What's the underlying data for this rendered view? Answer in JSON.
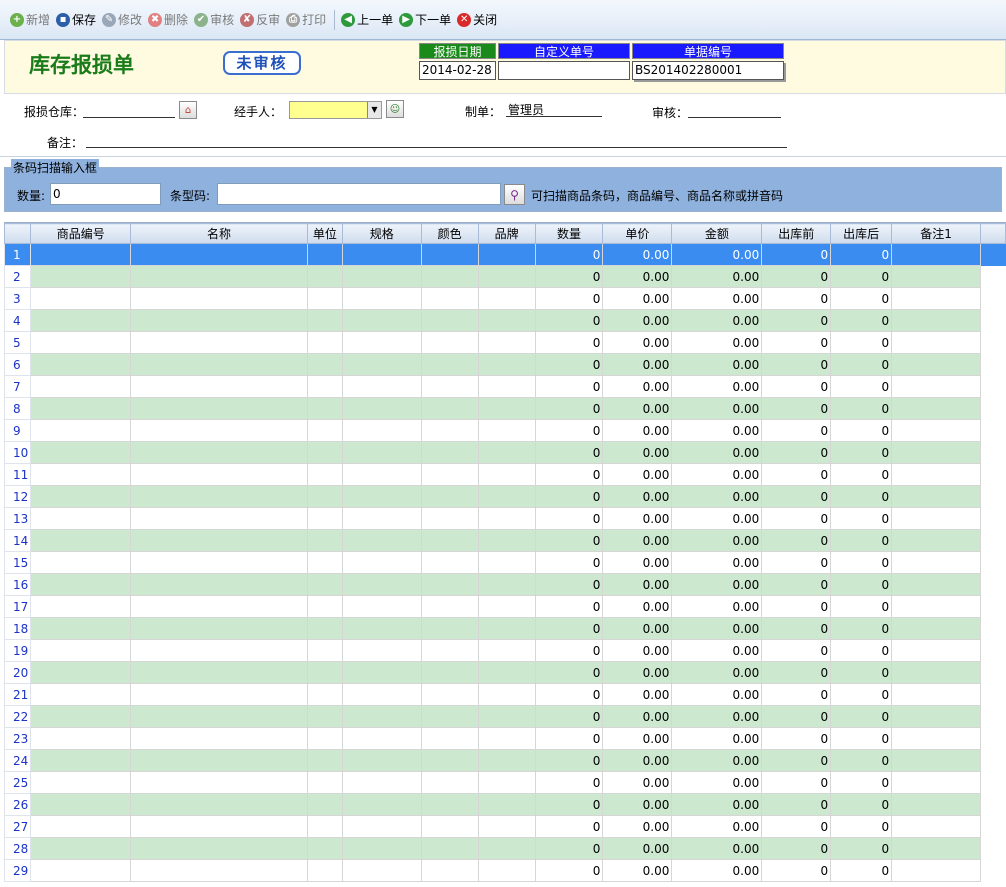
{
  "toolbar": {
    "buttons": [
      {
        "label": "新增",
        "icon": "plus-icon",
        "disabled": true
      },
      {
        "label": "保存",
        "icon": "floppy-icon",
        "disabled": false
      },
      {
        "label": "修改",
        "icon": "edit-icon",
        "disabled": true
      },
      {
        "label": "删除",
        "icon": "delete-icon",
        "disabled": true
      },
      {
        "label": "审核",
        "icon": "approve-icon",
        "disabled": true
      },
      {
        "label": "反审",
        "icon": "unapprove-icon",
        "disabled": true
      },
      {
        "label": "打印",
        "icon": "printer-icon",
        "disabled": true
      }
    ],
    "nav": [
      {
        "label": "上一单",
        "icon": "arrow-left-icon"
      },
      {
        "label": "下一单",
        "icon": "arrow-right-icon"
      },
      {
        "label": "关闭",
        "icon": "close-icon"
      }
    ]
  },
  "header": {
    "title": "库存报损单",
    "status_stamp": "未审核",
    "fields": [
      {
        "caption": "报损日期",
        "value": "2014-02-28",
        "caption_color": "#1a8a1a"
      },
      {
        "caption": "自定义单号",
        "value": "",
        "caption_color": "#1a1aff"
      },
      {
        "caption": "单据编号",
        "value": "BS201402280001",
        "caption_color": "#1a1aff"
      }
    ]
  },
  "form": {
    "warehouse_label": "报损仓库：",
    "warehouse_value": "",
    "handler_label": "经手人：",
    "handler_value": "",
    "maker_label": "制单：",
    "maker_value": "管理员",
    "auditor_label": "审核：",
    "auditor_value": "",
    "remark_label": "备注：",
    "remark_value": ""
  },
  "scan": {
    "legend": "条码扫描输入框",
    "qty_label": "数量:",
    "qty_value": "0",
    "barcode_label": "条型码:",
    "barcode_value": "",
    "hint": "可扫描商品条码，商品编号、商品名称或拼音码"
  },
  "grid": {
    "columns": [
      "",
      "商品编号",
      "名称",
      "单位",
      "规格",
      "颜色",
      "品牌",
      "数量",
      "单价",
      "金额",
      "出库前",
      "出库后",
      "备注1"
    ],
    "row_count": 29,
    "default_values": {
      "qty": "0",
      "price": "0.00",
      "amount": "0.00",
      "before": "0",
      "after": "0"
    },
    "selected_row": 1
  }
}
